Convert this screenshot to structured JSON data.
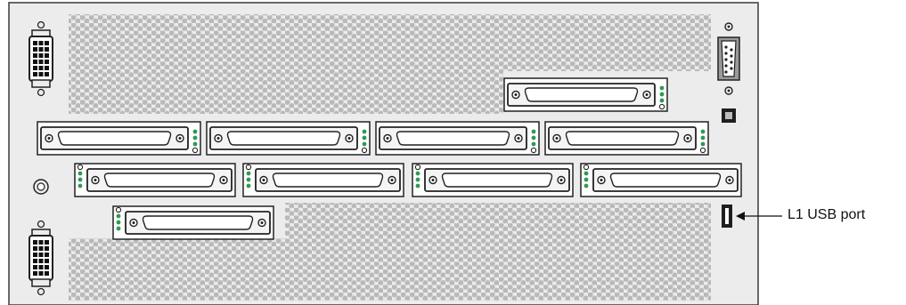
{
  "diagram": {
    "callout_label": "L1 USB port",
    "colors": {
      "panel_fill": "#ececec",
      "panel_stroke": "#3a3a3a",
      "vent_hole": "#b9b9b9",
      "connector_fill": "#f4f4f4",
      "connector_stroke": "#222222",
      "led_green": "#2e9a52",
      "dark": "#1f1f1f"
    },
    "components": [
      {
        "kind": "power-connector",
        "name": "power-connector-top"
      },
      {
        "kind": "power-connector",
        "name": "power-connector-bottom"
      },
      {
        "kind": "serial-port",
        "name": "serial-port"
      },
      {
        "kind": "square-indicator",
        "name": "square-indicator"
      },
      {
        "kind": "round-button",
        "name": "round-button"
      },
      {
        "kind": "usb-port",
        "name": "l1-usb-port"
      },
      {
        "kind": "scsi-slot",
        "count": 10
      }
    ]
  }
}
